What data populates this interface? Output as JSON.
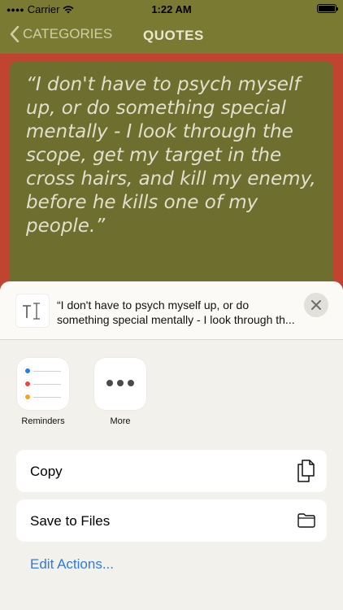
{
  "status_bar": {
    "carrier": "Carrier",
    "time": "1:22 AM",
    "battery_level": 1.0
  },
  "nav": {
    "back_label": "CATEGORIES",
    "title": "QUOTES"
  },
  "quote": {
    "text": "“I don't have to psych myself up, or do something special mentally - I look through the scope, get my target in the cross hairs, and kill my enemy, before he kills one of my people.”"
  },
  "share_sheet": {
    "preview_text": "“I don't have to psych myself up, or do something special mentally - I look through th...",
    "apps": [
      {
        "label": "Reminders",
        "icon": "reminders-icon"
      },
      {
        "label": "More",
        "icon": "more-icon"
      }
    ],
    "actions": [
      {
        "label": "Copy",
        "icon": "copy-icon"
      },
      {
        "label": "Save to Files",
        "icon": "folder-icon"
      }
    ],
    "edit_actions_label": "Edit Actions..."
  },
  "colors": {
    "nav_bar": "#7b7a33",
    "quote_card": "#6e6e2e",
    "background": "#c0442f",
    "link_blue": "#2f7ae5",
    "reminder_blue": "#1e7ff0",
    "reminder_red": "#e8473b",
    "reminder_orange": "#f4a423"
  }
}
